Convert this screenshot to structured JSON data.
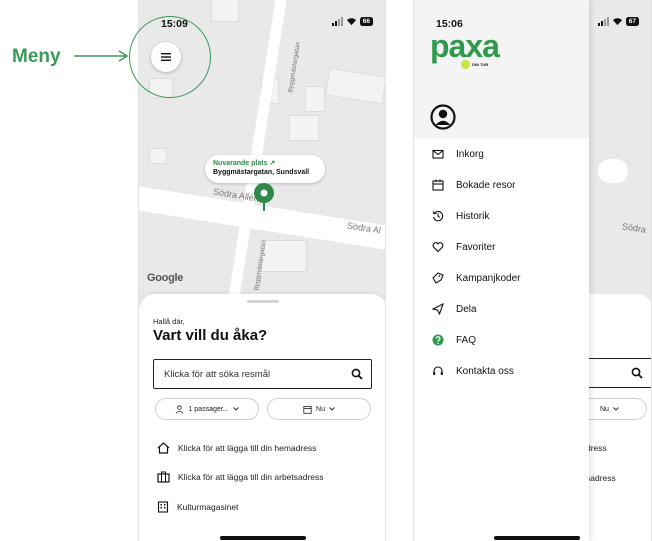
{
  "annotation": {
    "label": "Meny",
    "accent": "#3a9a5a"
  },
  "left_screen": {
    "status": {
      "time": "15:09",
      "battery": "66"
    },
    "map": {
      "street_1": "Byggmästargatan",
      "street_2": "Södra Allén",
      "street_3": "Södra Al",
      "street_4": "Byggmästargatan",
      "provider": "Google"
    },
    "location": {
      "title": "Nuvarande plats ↗",
      "address": "Byggmästargatan, Sundsvall"
    },
    "sheet": {
      "greeting": "Hallå där,",
      "headline": "Vart vill du åka?",
      "search_placeholder": "Klicka för att söka resmål",
      "passengers": "1 passager...",
      "time_chip": "Nu",
      "home_address": "Klicka för att lägga till din hemadress",
      "work_address": "Klicka för att lägga till din arbetsadress",
      "saved_place": "Kulturmagasinet"
    }
  },
  "right_screen": {
    "status": {
      "time": "15:06",
      "battery": "67"
    },
    "logo": "paxa",
    "logo_tagline": "DIN TUR",
    "menu": [
      {
        "label": "Inkorg",
        "icon": "mail-icon"
      },
      {
        "label": "Bokade resor",
        "icon": "calendar-icon"
      },
      {
        "label": "Historik",
        "icon": "history-icon"
      },
      {
        "label": "Favoriter",
        "icon": "heart-icon"
      },
      {
        "label": "Kampanjkoder",
        "icon": "promo-icon"
      },
      {
        "label": "Dela",
        "icon": "share-icon"
      },
      {
        "label": "FAQ",
        "icon": "faq-icon"
      },
      {
        "label": "Kontakta oss",
        "icon": "headset-icon"
      }
    ],
    "background": {
      "street": "Södra",
      "time_chip": "Nu",
      "home_fragment": "dress",
      "work_fragment": "sadress"
    }
  }
}
